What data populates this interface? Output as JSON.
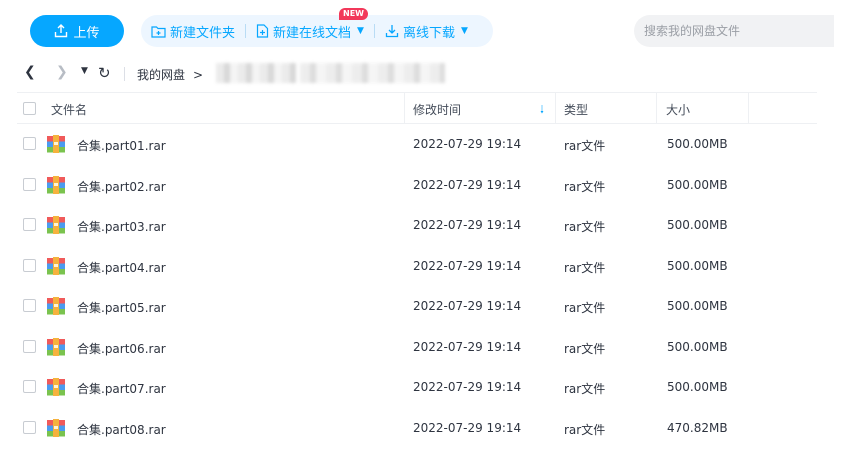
{
  "toolbar": {
    "upload_label": "上传",
    "new_folder_label": "新建文件夹",
    "new_online_doc_label": "新建在线文档",
    "new_badge": "NEW",
    "offline_download_label": "离线下载",
    "search_placeholder": "搜索我的网盘文件"
  },
  "breadcrumb": {
    "root": "我的网盘",
    "separator": ">"
  },
  "table": {
    "headers": {
      "name": "文件名",
      "modified": "修改时间",
      "type": "类型",
      "size": "大小"
    },
    "rows": [
      {
        "name": "合集.part01.rar",
        "modified": "2022-07-29 19:14",
        "type": "rar文件",
        "size": "500.00MB"
      },
      {
        "name": "合集.part02.rar",
        "modified": "2022-07-29 19:14",
        "type": "rar文件",
        "size": "500.00MB"
      },
      {
        "name": "合集.part03.rar",
        "modified": "2022-07-29 19:14",
        "type": "rar文件",
        "size": "500.00MB"
      },
      {
        "name": "合集.part04.rar",
        "modified": "2022-07-29 19:14",
        "type": "rar文件",
        "size": "500.00MB"
      },
      {
        "name": "合集.part05.rar",
        "modified": "2022-07-29 19:14",
        "type": "rar文件",
        "size": "500.00MB"
      },
      {
        "name": "合集.part06.rar",
        "modified": "2022-07-29 19:14",
        "type": "rar文件",
        "size": "500.00MB"
      },
      {
        "name": "合集.part07.rar",
        "modified": "2022-07-29 19:14",
        "type": "rar文件",
        "size": "500.00MB"
      },
      {
        "name": "合集.part08.rar",
        "modified": "2022-07-29 19:14",
        "type": "rar文件",
        "size": "470.82MB"
      }
    ]
  },
  "colors": {
    "accent": "#06a7ff",
    "badge": "#f2385a",
    "group_bg": "#edf6ff"
  },
  "icons": [
    "upload-icon",
    "new-folder-icon",
    "new-doc-icon",
    "download-icon",
    "back-icon",
    "forward-icon",
    "dropdown-icon",
    "refresh-icon",
    "sort-desc-icon",
    "rar-file-icon"
  ]
}
